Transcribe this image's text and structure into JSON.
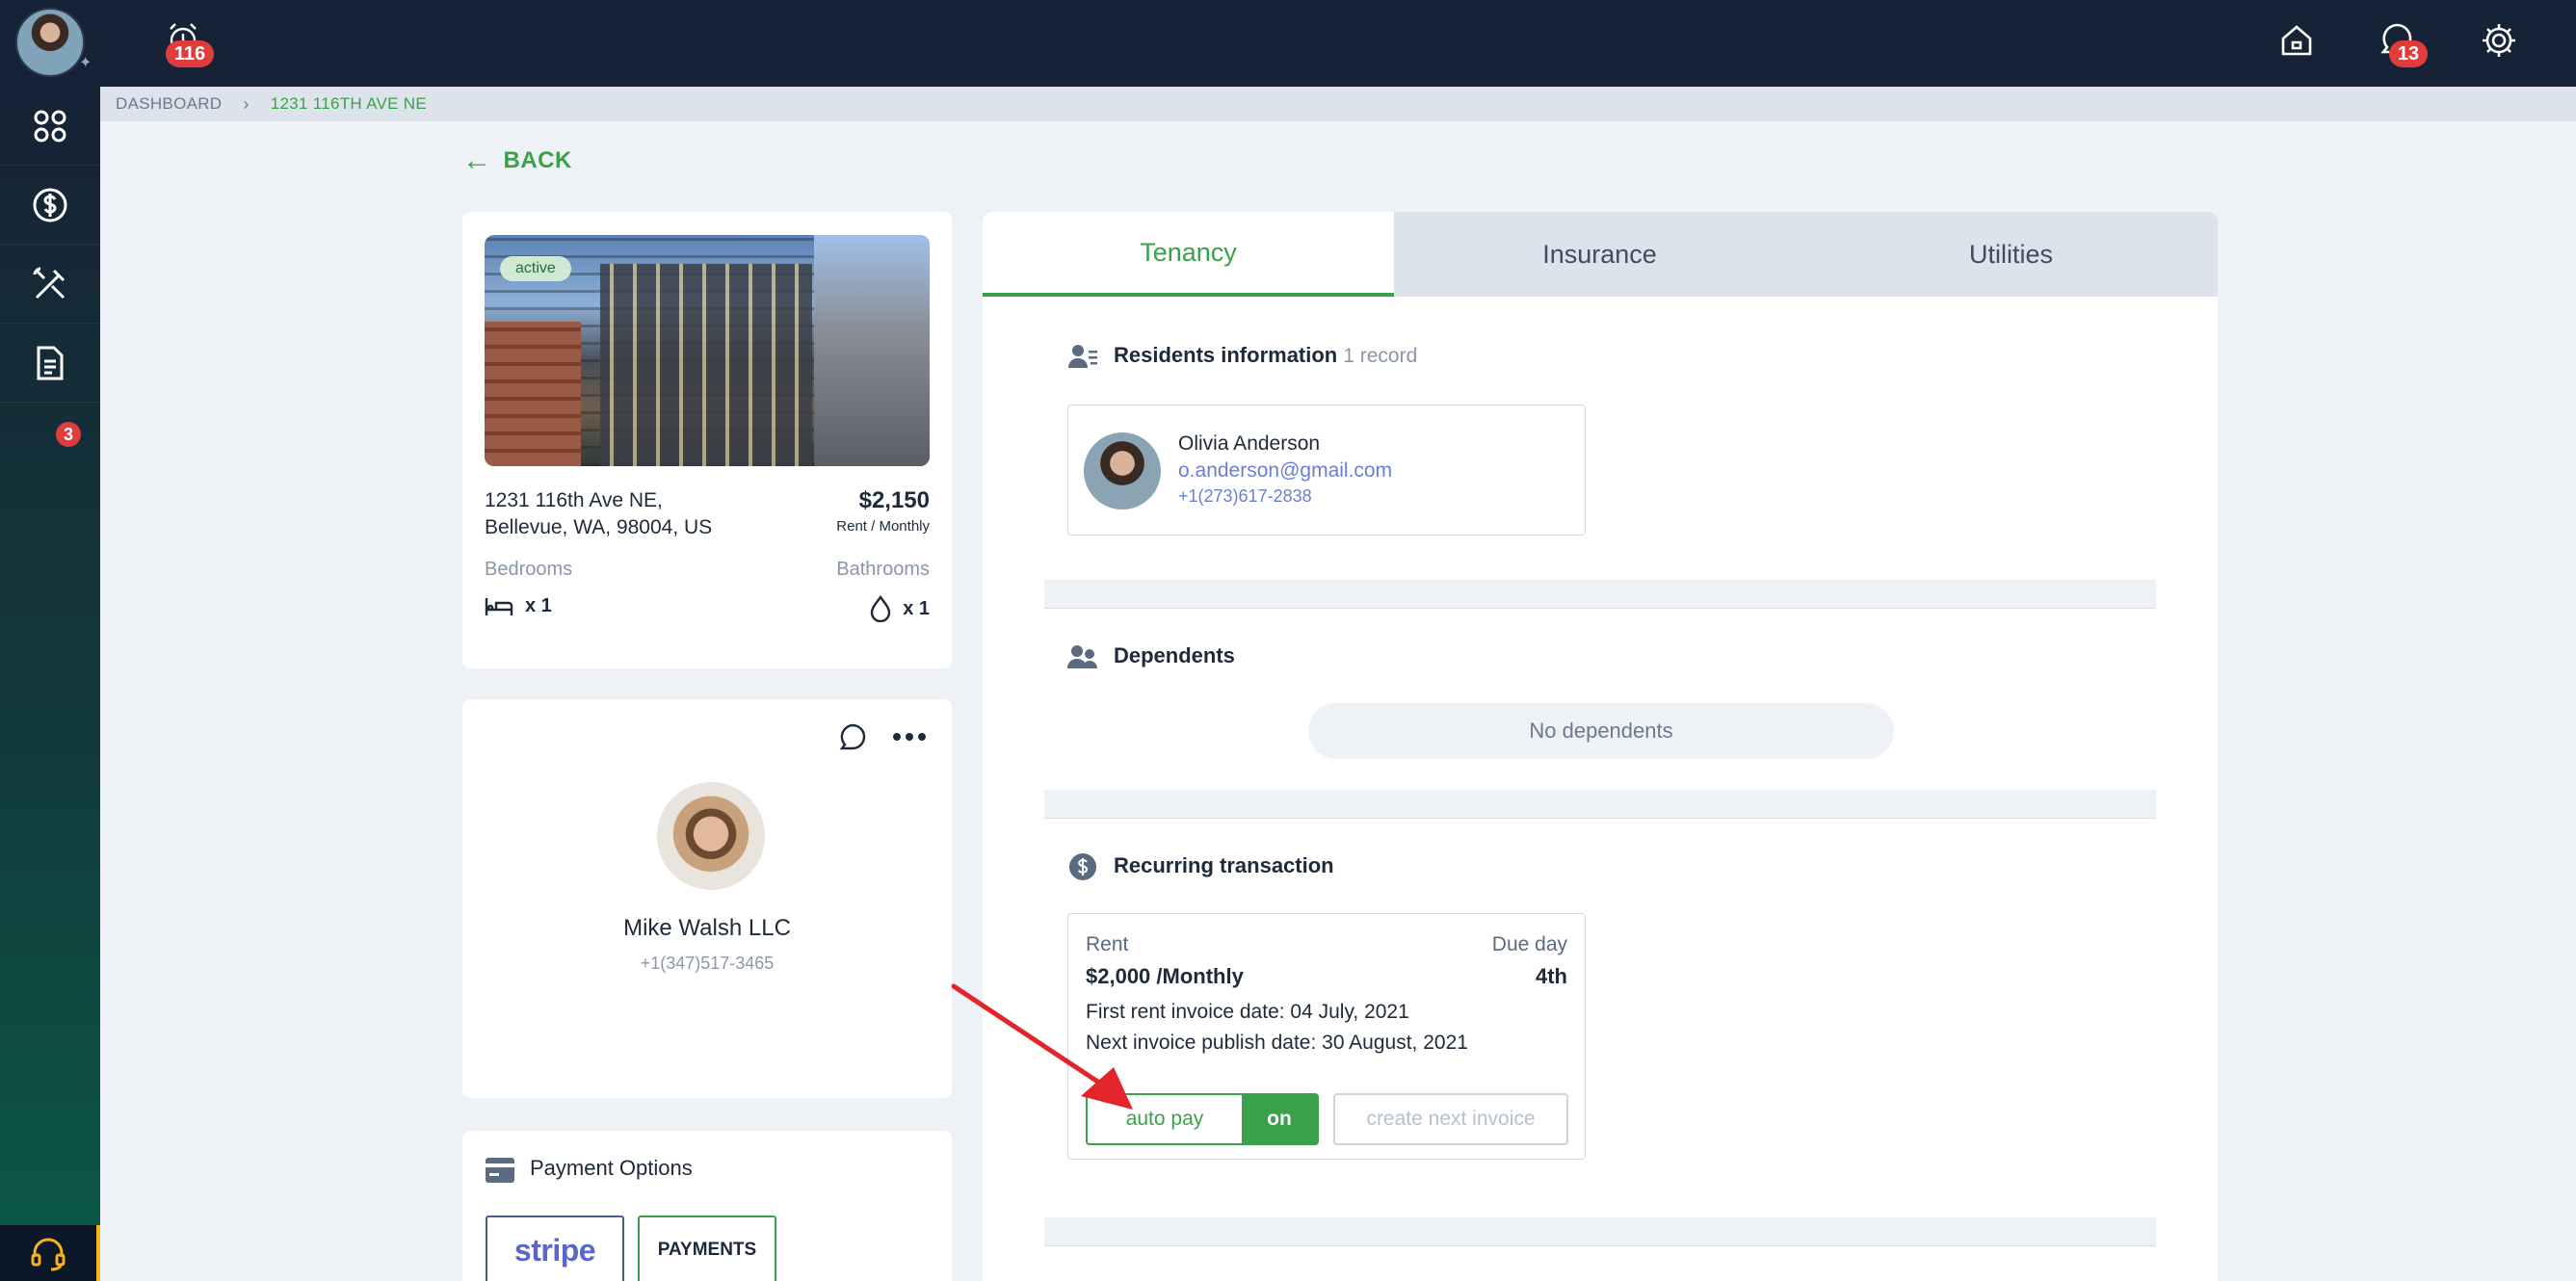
{
  "topbar": {
    "alarm_badge": "116",
    "notifications_badge": "13",
    "icons": [
      "alarm-icon",
      "home-icon",
      "chat-bell-icon",
      "gear-icon"
    ]
  },
  "sidebar": {
    "items": [
      {
        "name": "dashboard",
        "icon": "grid-icon"
      },
      {
        "name": "payments",
        "icon": "dollar-icon"
      },
      {
        "name": "maintenance",
        "icon": "tools-icon"
      },
      {
        "name": "documents",
        "icon": "document-icon",
        "badge": "3"
      }
    ],
    "support_icon": "headset-icon"
  },
  "breadcrumb": {
    "root": "DASHBOARD",
    "current": "1231 116TH AVE NE"
  },
  "back_label": "BACK",
  "property": {
    "status": "active",
    "address_line1": "1231 116th Ave NE,",
    "address_line2": "Bellevue, WA, 98004, US",
    "price": "$2,150",
    "price_period": "Rent / Monthly",
    "bedrooms_label": "Bedrooms",
    "bedrooms_value": "x 1",
    "bathrooms_label": "Bathrooms",
    "bathrooms_value": "x 1"
  },
  "owner": {
    "name": "Mike Walsh LLC",
    "phone": "+1(347)517-3465"
  },
  "payment_options": {
    "title": "Payment Options",
    "providers": [
      "stripe",
      "PAYMENTS"
    ]
  },
  "tabs": [
    {
      "label": "Tenancy",
      "active": true
    },
    {
      "label": "Insurance",
      "active": false
    },
    {
      "label": "Utilities",
      "active": false
    }
  ],
  "residents": {
    "title": "Residents information",
    "count": "1 record",
    "resident": {
      "name": "Olivia Anderson",
      "email": "o.anderson@gmail.com",
      "phone": "+1(273)617-2838"
    }
  },
  "dependents": {
    "title": "Dependents",
    "empty": "No dependents"
  },
  "recurring": {
    "title": "Recurring transaction",
    "type_label": "Rent",
    "due_label": "Due day",
    "amount": "$2,000 /Monthly",
    "due_day": "4th",
    "first_invoice": "First rent invoice date: 04 July, 2021",
    "next_invoice": "Next invoice publish date: 30 August, 2021",
    "autopay_label": "auto pay",
    "autopay_state": "on",
    "create_invoice_label": "create next invoice"
  },
  "colors": {
    "accent": "#3aa14a",
    "topbar": "#162235",
    "badge": "#e03c3c",
    "link": "#6a7fd4"
  }
}
